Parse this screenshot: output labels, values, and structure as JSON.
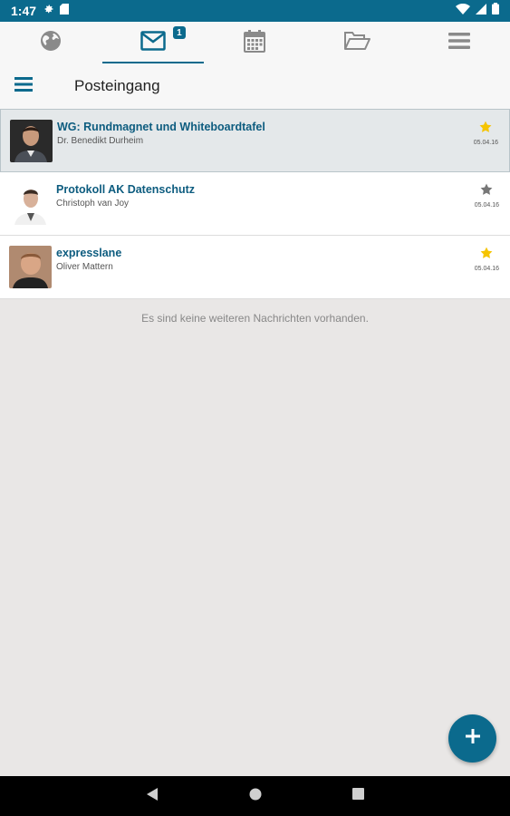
{
  "status_bar": {
    "time": "1:47"
  },
  "tabs": [
    {
      "name": "globe-icon",
      "active": false
    },
    {
      "name": "mail-icon",
      "active": true,
      "badge": "1"
    },
    {
      "name": "calendar-icon",
      "active": false
    },
    {
      "name": "folder-open-icon",
      "active": false
    },
    {
      "name": "menu-icon",
      "active": false
    }
  ],
  "header": {
    "title": "Posteingang"
  },
  "messages": [
    {
      "subject": "WG: Rundmagnet und Whiteboardtafel",
      "sender": "Dr. Benedikt Durheim",
      "date": "05.04.16",
      "starred": true,
      "selected": true
    },
    {
      "subject": "Protokoll AK Datenschutz",
      "sender": "Christoph van Joy",
      "date": "05.04.16",
      "starred": false,
      "selected": false
    },
    {
      "subject": "expresslane",
      "sender": "Oliver Mattern",
      "date": "05.04.16",
      "starred": true,
      "selected": false
    }
  ],
  "empty_note": "Es sind keine weiteren Nachrichten vorhanden.",
  "colors": {
    "accent": "#0b6a8d",
    "star_active": "#f5c400",
    "star_inactive": "#777777",
    "background": "#e9e7e6"
  }
}
